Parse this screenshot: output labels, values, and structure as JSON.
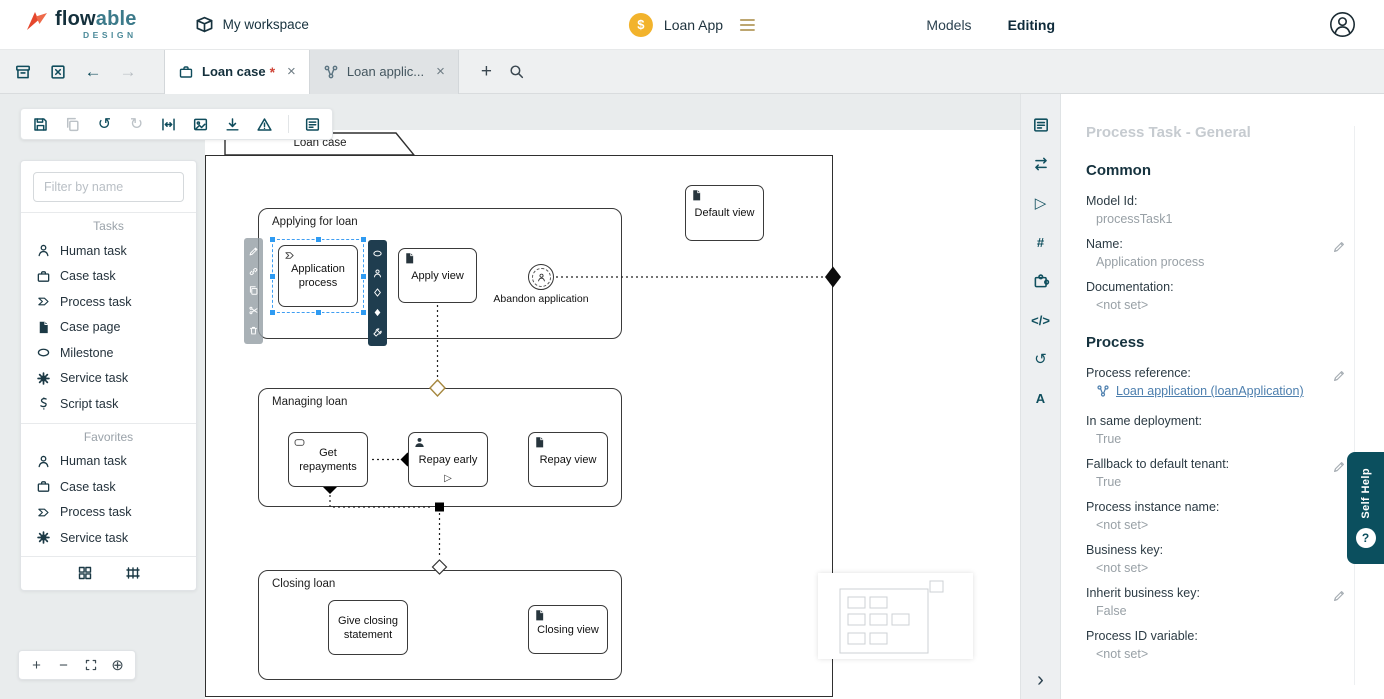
{
  "colors": {
    "accent": "#0d4f5c",
    "selection": "#3f9ef2",
    "badge": "#f2b32c",
    "modified": "#cf4437",
    "link": "#4d7fae"
  },
  "icons": {
    "undo": "↺",
    "redo": "↻",
    "back": "←",
    "forward": "→",
    "plus": "+",
    "close": "×",
    "modified": "*",
    "play": "▷",
    "hash": "#",
    "code": "</>",
    "history": "↺",
    "letter_a": "A",
    "chevron_right": "›",
    "zoom_in": "+",
    "zoom_out": "−",
    "center": "⊕",
    "decorator_manual": "▷",
    "dollar": "$",
    "question": "?"
  },
  "header": {
    "brand_flow": "flow",
    "brand_able": "able",
    "brand_sub": "DESIGN",
    "workspace": "My workspace",
    "app_name": "Loan App",
    "models": "Models",
    "editing": "Editing"
  },
  "tabbar": {
    "tab1_label": "Loan case",
    "tab2_label": "Loan applic..."
  },
  "palette": {
    "filter_placeholder": "Filter by name",
    "sections": [
      {
        "title": "Tasks",
        "items": [
          "Human task",
          "Case task",
          "Process task",
          "Case page",
          "Milestone",
          "Service task",
          "Script task"
        ]
      },
      {
        "title": "Favorites",
        "items": [
          "Human task",
          "Case task",
          "Process task",
          "Service task"
        ]
      }
    ]
  },
  "diagram": {
    "case_title": "Loan case",
    "stages": {
      "applying": "Applying for loan",
      "managing": "Managing loan",
      "closing": "Closing loan"
    },
    "nodes": {
      "application_process": "Application process",
      "apply_view": "Apply view",
      "abandon": "Abandon application",
      "default_view": "Default view",
      "get_repayments": "Get repayments",
      "repay_early": "Repay early",
      "repay_view": "Repay view",
      "give_closing": "Give closing statement",
      "closing_view": "Closing view"
    }
  },
  "properties": {
    "title": "Process Task - General",
    "common": "Common",
    "process": "Process",
    "fields": {
      "model_id": {
        "label": "Model Id:",
        "value": "processTask1"
      },
      "name": {
        "label": "Name:",
        "value": "Application process"
      },
      "documentation": {
        "label": "Documentation:",
        "value": "<not set>"
      },
      "process_reference": {
        "label": "Process reference:",
        "value": "Loan application (loanApplication)"
      },
      "in_same_deployment": {
        "label": "In same deployment:",
        "value": "True"
      },
      "fallback": {
        "label": "Fallback to default tenant:",
        "value": "True"
      },
      "process_instance_name": {
        "label": "Process instance name:",
        "value": "<not set>"
      },
      "business_key": {
        "label": "Business key:",
        "value": "<not set>"
      },
      "inherit_business_key": {
        "label": "Inherit business key:",
        "value": "False"
      },
      "process_id_variable": {
        "label": "Process ID variable:",
        "value": "<not set>"
      }
    }
  },
  "self_help": {
    "label": "Self Help",
    "badge": "?"
  }
}
